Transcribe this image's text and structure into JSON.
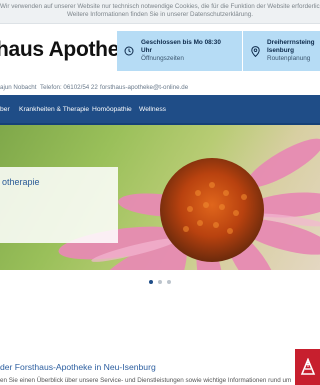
{
  "cookie": {
    "line1": "Wir verwenden auf unserer Website nur technisch notwendige Cookies, die für die Funktion der Website erforderlich sind.",
    "line2": "Weitere Informationen finden Sie in unserer Datenschutzerklärung."
  },
  "header": {
    "brand": "haus Apotheke",
    "hours": {
      "title_line1": "Geschlossen bis Mo 08:30",
      "title_line2": "Uhr",
      "sub": "Öffnungszeiten",
      "icon": "clock-icon"
    },
    "address": {
      "title_line1": "Dreiherrnsteing",
      "title_line2": "Isenburg",
      "sub": "Routenplanung",
      "icon": "location-pin-icon"
    }
  },
  "contact": {
    "owner": "ajun Nobacht",
    "phone": "Telefon: 06102/54 22",
    "email": "forsthaus-apotheke@t-online.de"
  },
  "nav": {
    "items": [
      "ber",
      "Krankheiten & Therapie",
      "Homöopathie",
      "Wellness"
    ]
  },
  "hero": {
    "card_text": "otherapie",
    "slides": 3,
    "active_slide": 1
  },
  "intro": {
    "title": "der Forsthaus-Apotheke in Neu-Isenburg",
    "text": "en Sie einen Überblick über unsere Service- und Dienstleistungen sowie wichtige Informationen rund um"
  },
  "colors": {
    "primary": "#1f4d87",
    "info_box": "#b6dcf5",
    "badge": "#c71f2e"
  }
}
